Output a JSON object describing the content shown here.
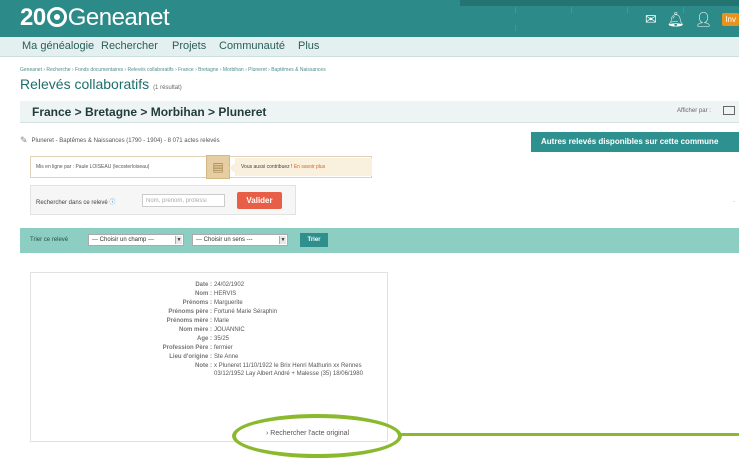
{
  "header": {
    "logo_num": "20",
    "logo_text": "Geneanet",
    "icons": [
      "mail-icon",
      "bell-icon",
      "user-icon"
    ],
    "badge_text": "Inv"
  },
  "nav": {
    "items": [
      "Ma généalogie",
      "Rechercher",
      "Projets",
      "Communauté",
      "Plus"
    ]
  },
  "breadcrumb": "Geneanet › Recherche › Fonds documentaires › Relevés collaboratifs › France › Bretagne › Morbihan › Pluneret › Baptêmes & Naissances",
  "page": {
    "title": "Relevés collaboratifs",
    "count": "(1 résultat)"
  },
  "location": {
    "path": "France > Bretagne > Morbihan > Pluneret",
    "display_label": "Afficher par :"
  },
  "record_source": "Pluneret - Baptêmes & Naissances (1790 - 1904) - 8 071 actes relevés",
  "others_button": "Autres relevés disponibles sur cette commune",
  "contrib": {
    "left": "Mis en ligne par : Paule LOISEAU (lecosterloiseau)",
    "right_text": "Vous aussi contribuez ! ",
    "right_link": "En savoir plus"
  },
  "search": {
    "label": "Rechercher dans ce relevé",
    "placeholder": "Nom, prénom, professi",
    "button": "Valider"
  },
  "sort": {
    "label": "Trier ce relevé",
    "field_select": "--- Choisir un champ ---",
    "order_select": "--- Choisir un sens ---",
    "button": "Trier"
  },
  "record": {
    "fields": [
      {
        "label": "Date :",
        "value": "24/02/1902"
      },
      {
        "label": "Nom :",
        "value": "HERVIS"
      },
      {
        "label": "Prénoms :",
        "value": "Marguerite"
      },
      {
        "label": "Prénoms père :",
        "value": "Fortuné Marie Séraphin"
      },
      {
        "label": "Prénoms mère :",
        "value": "Marie"
      },
      {
        "label": "Nom mère :",
        "value": "JOUANNIC"
      },
      {
        "label": "Age :",
        "value": "35/25"
      },
      {
        "label": "Profession Père :",
        "value": "fermier"
      },
      {
        "label": "Lieu d'origine :",
        "value": "Ste Anne"
      },
      {
        "label": "Note :",
        "value": "x Pluneret 11/10/1922 le Brix Henri Mathurin xx Rennes 03/12/1952 Lay Albert André + Malesse (35) 18/06/1980"
      }
    ],
    "original_link": "› Rechercher l'acte original"
  },
  "colors": {
    "header_teal": "#2c8a88",
    "valider_red": "#e85f47",
    "sort_band": "#8ccfc2",
    "highlight_green": "#8ab92d"
  }
}
